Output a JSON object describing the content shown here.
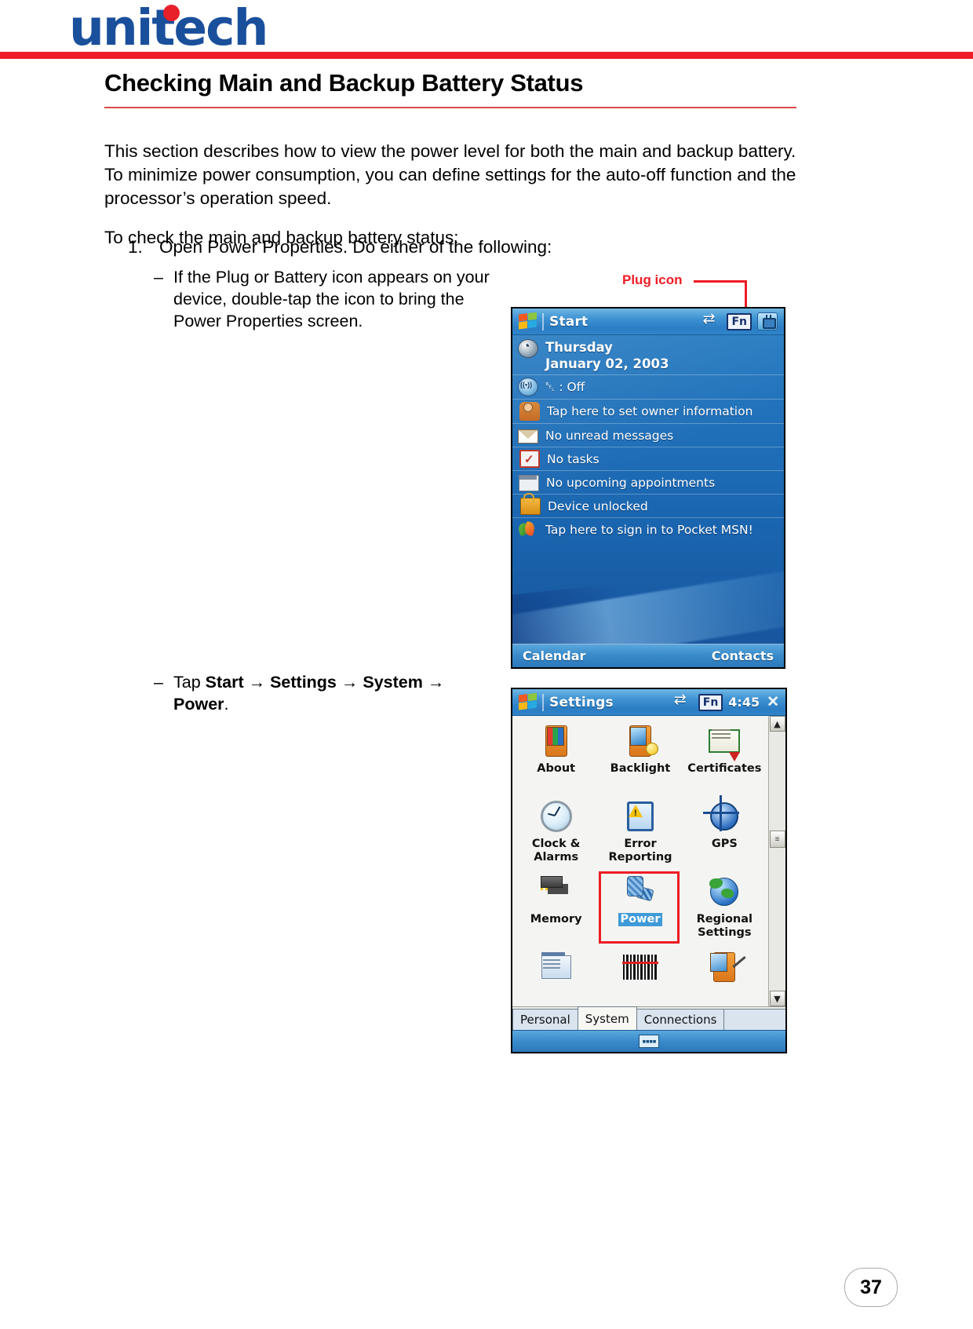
{
  "brand": {
    "logo_text": "unitech",
    "logo_color": "#1a4f9c",
    "accent_color": "#ee1c25"
  },
  "section": {
    "title": "Checking Main and Backup Battery Status"
  },
  "content": {
    "paragraph_1": "This section describes how to view the power level for both the main and backup battery. To minimize power consumption, you can define settings for the auto-off function and the processor’s operation speed.",
    "paragraph_2": "To check the main and backup battery status:",
    "step_1_number": "1.",
    "step_1_text": "Open Power Properties. Do either of the following:",
    "bullet_1_marker": "–",
    "bullet_1_text": "If the Plug or Battery icon appears on your device, double-tap the icon to bring the Power Properties screen.",
    "bullet_2_marker": "–",
    "bullet_2_prefix": "Tap ",
    "bullet_2_start": "Start",
    "bullet_2_arrow1": " → ",
    "bullet_2_settings": "Settings",
    "bullet_2_arrow2": " → ",
    "bullet_2_system": "System",
    "bullet_2_arrow3": " → ",
    "bullet_2_power": "Power",
    "bullet_2_suffix": "."
  },
  "callout": {
    "plug_icon_label": "Plug icon",
    "color": "#ee1c25"
  },
  "today_screen": {
    "titlebar": {
      "start_label": "Start",
      "windows_flag_icon": "windows-flag-icon",
      "sync_icon": "sync-arrows-icon",
      "fn_label": "Fn",
      "plug_icon": "plug-icon"
    },
    "rows": [
      {
        "icon": "clock-icon",
        "label": "Thursday\nJanuary 02, 2003",
        "label_line1": "Thursday",
        "label_line2": "January 02, 2003"
      },
      {
        "icon": "wireless-icon",
        "label": "␇ : Off",
        "bt_prefix": "ᛦ",
        "bt_text": " : Off"
      },
      {
        "icon": "owner-icon",
        "label": "Tap here to set owner information"
      },
      {
        "icon": "mail-icon",
        "label": "No unread messages"
      },
      {
        "icon": "tasks-icon",
        "label": "No tasks"
      },
      {
        "icon": "calendar-icon",
        "label": "No upcoming appointments"
      },
      {
        "icon": "lock-open-icon",
        "label": "Device unlocked"
      },
      {
        "icon": "msn-butterfly-icon",
        "label": "Tap here to sign in to Pocket MSN!"
      }
    ],
    "footer": {
      "left_label": "Calendar",
      "right_label": "Contacts"
    }
  },
  "settings_screen": {
    "titlebar": {
      "title": "Settings",
      "windows_flag_icon": "windows-flag-icon",
      "sync_icon": "sync-arrows-icon",
      "fn_label": "Fn",
      "time": "4:45",
      "close_icon": "close-icon"
    },
    "items": [
      {
        "label": "About",
        "icon": "about-device-icon",
        "selected": false
      },
      {
        "label": "Backlight",
        "icon": "backlight-icon",
        "selected": false
      },
      {
        "label": "Certificates",
        "icon": "certificate-icon",
        "selected": false
      },
      {
        "label": "Clock &\nAlarms",
        "icon": "clock-alarms-icon",
        "selected": false,
        "label_line1": "Clock &",
        "label_line2": "Alarms"
      },
      {
        "label": "Error\nReporting",
        "icon": "error-reporting-icon",
        "selected": false,
        "label_line1": "Error",
        "label_line2": "Reporting"
      },
      {
        "label": "GPS",
        "icon": "gps-icon",
        "selected": false
      },
      {
        "label": "Memory",
        "icon": "memory-icon",
        "selected": false
      },
      {
        "label": "Power",
        "icon": "power-icon",
        "selected": true
      },
      {
        "label": "Regional\nSettings",
        "icon": "regional-settings-icon",
        "selected": false,
        "label_line1": "Regional",
        "label_line2": "Settings"
      },
      {
        "label": "",
        "icon": "remove-programs-icon",
        "selected": false
      },
      {
        "label": "",
        "icon": "barcode-scanner-icon",
        "selected": false
      },
      {
        "label": "",
        "icon": "screen-icon",
        "selected": false
      }
    ],
    "scrollbar": {
      "up_arrow": "▲",
      "down_arrow": "▼",
      "thumb": "≡"
    },
    "tabs": [
      {
        "label": "Personal",
        "active": false
      },
      {
        "label": "System",
        "active": true
      },
      {
        "label": "Connections",
        "active": false
      }
    ],
    "sip": {
      "keyboard_icon": "keyboard-icon",
      "keyboard_glyph": "⌨"
    }
  },
  "footer": {
    "page_number": "37"
  }
}
